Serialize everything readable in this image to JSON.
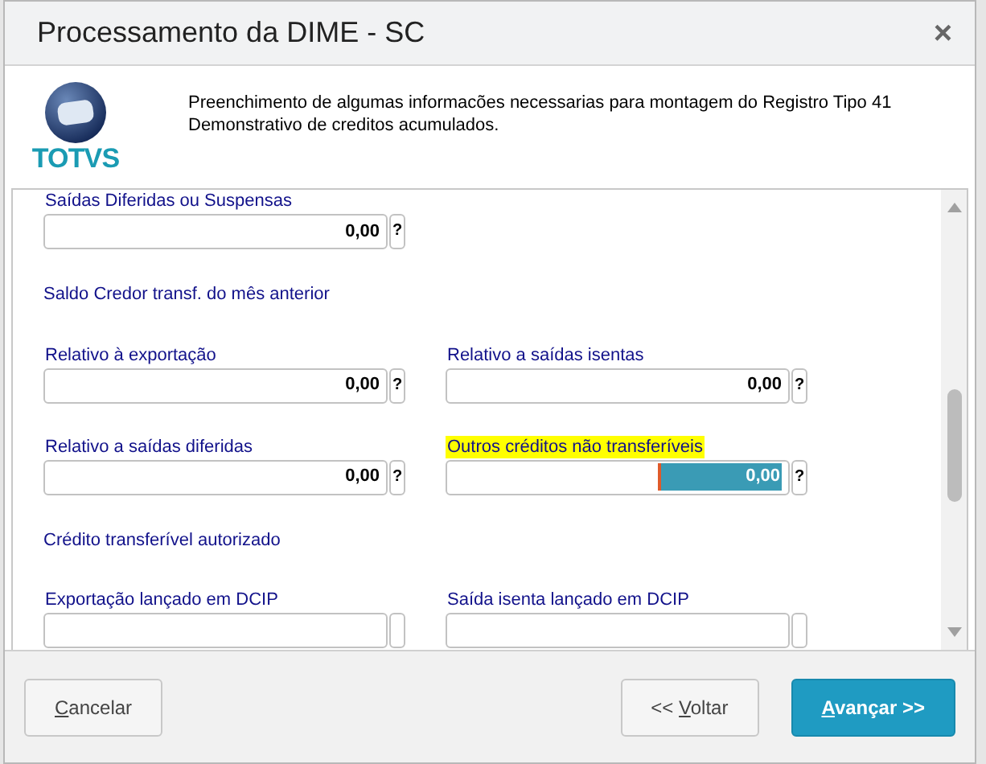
{
  "window": {
    "title": "Processamento da DIME - SC",
    "close": "×"
  },
  "header": {
    "logo_text": "TOTVS",
    "description": "Preenchimento de algumas informacões necessarias para montagem do Registro Tipo 41 Demonstrativo de creditos acumulados."
  },
  "form": [
    {
      "kind": "fields",
      "fields": [
        {
          "label": "Saídas Diferidas ou Suspensas",
          "value": "0,00",
          "help": "?",
          "focused": false
        }
      ]
    },
    {
      "kind": "heading",
      "text": "Saldo Credor transf. do mês anterior"
    },
    {
      "kind": "fields",
      "fields": [
        {
          "label": "Relativo à exportação",
          "value": "0,00",
          "help": "?",
          "focused": false
        },
        {
          "label": "Relativo a saídas isentas",
          "value": "0,00",
          "help": "?",
          "focused": false
        }
      ]
    },
    {
      "kind": "fields",
      "fields": [
        {
          "label": "Relativo a saídas diferidas",
          "value": "0,00",
          "help": "?",
          "focused": false
        },
        {
          "label": "Outros créditos não transferíveis",
          "value": "0,00",
          "help": "?",
          "focused": true
        }
      ]
    },
    {
      "kind": "heading",
      "text": "Crédito transferível autorizado"
    },
    {
      "kind": "fields",
      "fields": [
        {
          "label": "Exportação lançado em DCIP",
          "focused": false
        },
        {
          "label": "Saída isenta lançado em DCIP",
          "focused": false
        }
      ]
    }
  ],
  "buttons": [
    {
      "key": "C",
      "after": "ancelar",
      "primary": false
    },
    {
      "before": "<< ",
      "key": "V",
      "after": "oltar",
      "primary": false
    },
    {
      "key": "A",
      "after": "vançar >>",
      "primary": true
    }
  ]
}
